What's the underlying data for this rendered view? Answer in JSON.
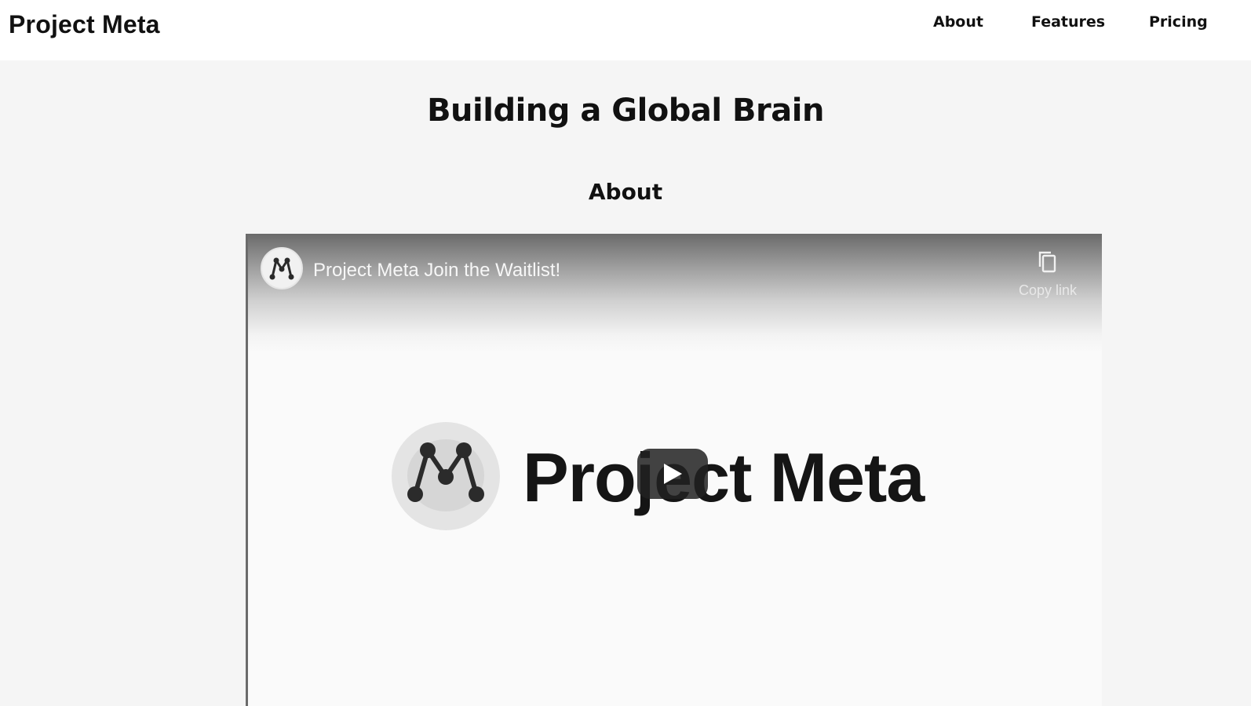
{
  "header": {
    "brand": "Project Meta",
    "nav": [
      "About",
      "Features",
      "Pricing"
    ]
  },
  "hero": {
    "title": "Building a Global Brain"
  },
  "about": {
    "title": "About"
  },
  "video": {
    "title": "Project Meta Join the Waitlist!",
    "copy_label": "Copy link",
    "thumbnail_text": "Project Meta",
    "icons": {
      "avatar": "project-meta-logo",
      "copy": "copy-icon",
      "play": "play-icon"
    }
  },
  "colors": {
    "page_bg": "#f5f5f5",
    "header_bg": "#ffffff",
    "text": "#111111",
    "play_bg": "#212121"
  }
}
